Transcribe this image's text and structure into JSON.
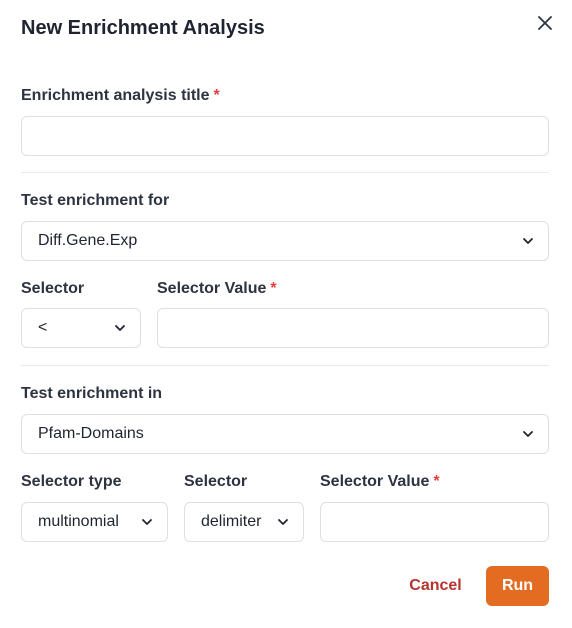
{
  "dialog": {
    "title": "New Enrichment Analysis"
  },
  "title_field": {
    "label": "Enrichment analysis title",
    "required_mark": "*",
    "value": ""
  },
  "test_for": {
    "label": "Test enrichment for",
    "value": "Diff.Gene.Exp",
    "selector": {
      "label": "Selector",
      "value": "<"
    },
    "selector_value": {
      "label": "Selector Value",
      "required_mark": "*",
      "value": ""
    }
  },
  "test_in": {
    "label": "Test enrichment in",
    "value": "Pfam-Domains",
    "selector_type": {
      "label": "Selector type",
      "value": "multinomial"
    },
    "selector": {
      "label": "Selector",
      "value": "delimiter"
    },
    "selector_value": {
      "label": "Selector Value",
      "required_mark": "*",
      "value": ""
    }
  },
  "actions": {
    "cancel_label": "Cancel",
    "run_label": "Run"
  },
  "icons": {
    "close": "close-icon",
    "dropdown": "chevron-down-icon"
  },
  "colors": {
    "accent": "#e36c22",
    "cancel": "#b5342e",
    "required": "#e53e3e"
  }
}
